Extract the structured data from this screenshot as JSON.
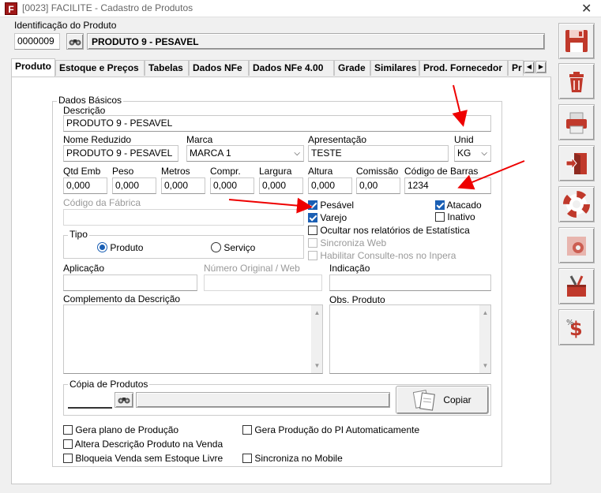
{
  "window": {
    "title": "[0023] FACILITE - Cadastro de Produtos",
    "app_icon_letter": "F"
  },
  "identificacao": {
    "label": "Identificação do Produto",
    "code": "0000009",
    "name": "PRODUTO 9 - PESAVEL"
  },
  "tabs": [
    "Produto",
    "Estoque e Preços",
    "Tabelas",
    "Dados NFe",
    "Dados NFe 4.00",
    "Grade",
    "Similares",
    "Prod. Fornecedor",
    "Pr"
  ],
  "dados_basicos": {
    "group_label": "Dados Básicos",
    "descricao_label": "Descrição",
    "descricao": "PRODUTO 9 - PESAVEL",
    "nome_reduzido_label": "Nome Reduzido",
    "nome_reduzido": "PRODUTO 9 - PESAVEL",
    "marca_label": "Marca",
    "marca": "MARCA 1",
    "apresentacao_label": "Apresentação",
    "apresentacao": "TESTE",
    "unid_label": "Unid",
    "unid": "KG",
    "qtd_emb_label": "Qtd Emb",
    "qtd_emb": "0,000",
    "peso_label": "Peso",
    "peso": "0,000",
    "metros_label": "Metros",
    "metros": "0,000",
    "compr_label": "Compr.",
    "compr": "0,000",
    "largura_label": "Largura",
    "largura": "0,000",
    "altura_label": "Altura",
    "altura": "0,000",
    "comissao_label": "Comissão",
    "comissao": "0,00",
    "codigo_barras_label": "Código de Barras",
    "codigo_barras": "1234",
    "codigo_fabrica_label": "Código da Fábrica",
    "codigo_fabrica": ""
  },
  "checks": {
    "pesavel": "Pesável",
    "atacado": "Atacado",
    "varejo": "Varejo",
    "inativo": "Inativo",
    "ocultar": "Ocultar nos relatórios de Estatística",
    "sincroniza_web": "Sincroniza Web",
    "habilitar": "Habilitar Consulte-nos no Inpera"
  },
  "tipo": {
    "label": "Tipo",
    "produto": "Produto",
    "servico": "Serviço"
  },
  "aplicacao_label": "Aplicação",
  "numero_original_label": "Número Original / Web",
  "indicacao_label": "Indicação",
  "complemento_label": "Complemento da Descrição",
  "obs_label": "Obs. Produto",
  "copia": {
    "label": "Cópia de Produtos",
    "button": "Copiar"
  },
  "bottom_checks": {
    "gera_plano": "Gera plano de Produção",
    "gera_producao": "Gera Produção do PI Automaticamente",
    "altera_descricao": "Altera Descrição Produto na Venda",
    "bloqueia_venda": "Bloqueia Venda sem Estoque Livre",
    "sincroniza_mobile": "Sincroniza no Mobile"
  },
  "colors": {
    "accent": "#1a5fb4",
    "arrow": "#e00000",
    "icon_red": "#c0392b"
  },
  "sidebar_icons": [
    "save-icon",
    "trash-icon",
    "printer-icon",
    "exit-door-icon",
    "lifebuoy-icon",
    "gear-settings-icon",
    "tools-icon",
    "dollar-percent-icon"
  ]
}
